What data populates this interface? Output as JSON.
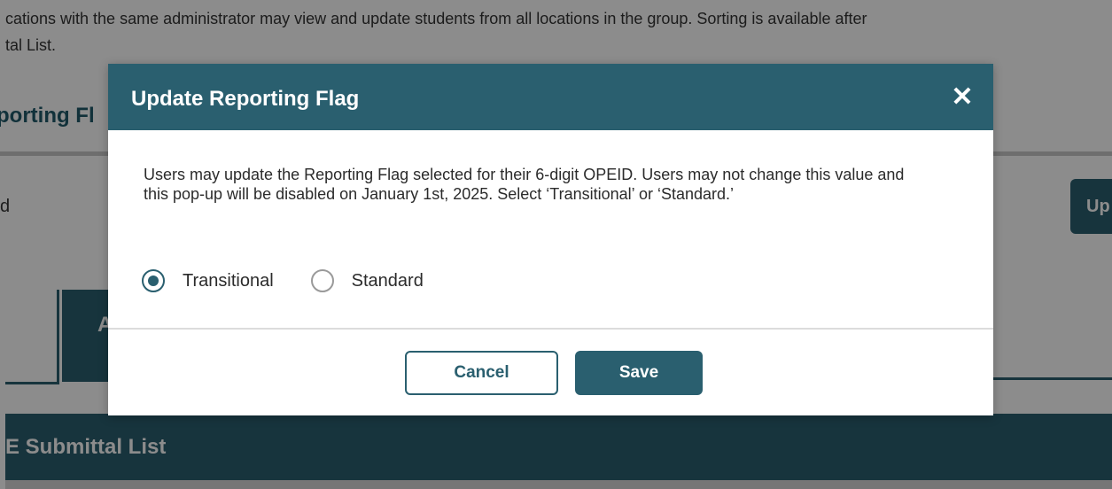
{
  "background": {
    "intro_line_1": "cations with the same administrator may view and update students from all locations in the group. Sorting is available after",
    "intro_line_2": "tal List.",
    "section_title": "porting Fl",
    "row_label": "d",
    "update_button_label": "Up",
    "tab_label": "A",
    "list_header": "E Submittal List"
  },
  "modal": {
    "title": "Update Reporting Flag",
    "close_glyph": "✕",
    "message": "Users may update the Reporting Flag selected for their 6-digit OPEID. Users may not change this value and this pop-up will be disabled on January 1st, 2025. Select ‘Transitional’ or ‘Standard.’",
    "options": [
      {
        "label": "Transitional",
        "selected": true
      },
      {
        "label": "Standard",
        "selected": false
      }
    ],
    "cancel_label": "Cancel",
    "save_label": "Save"
  },
  "colors": {
    "primary": "#2a5f6f",
    "overlay": "rgba(0,0,0,0.45)",
    "text": "#2b2b2b"
  },
  "icons": {
    "close": "close-icon",
    "radio_checked": "radio-checked-icon",
    "radio_unchecked": "radio-unchecked-icon"
  }
}
